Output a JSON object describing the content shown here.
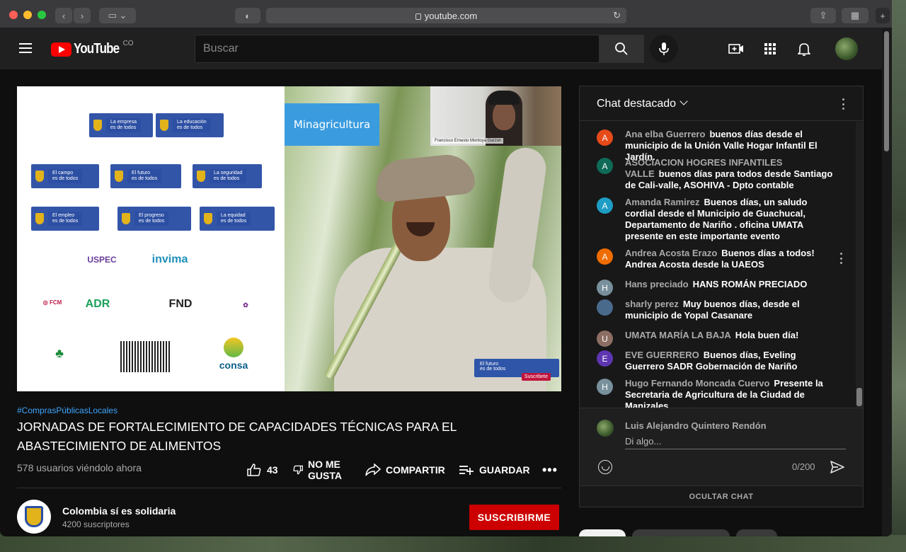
{
  "browser": {
    "url": "youtube.com"
  },
  "header": {
    "logo_text": "YouTube",
    "country_code": "CO",
    "search_placeholder": "Buscar"
  },
  "video": {
    "slide": {
      "minagri_label": "Minagricultura",
      "camera_name": "Francisco Ernesto Montoya Garzon",
      "badge_line1": "El futuro",
      "badge_line2": "es de todos",
      "badge_sub": "Suscribete"
    },
    "hashtag": "#ComprasPúblicasLocales",
    "title": "JORNADAS DE FORTALECIMIENTO DE CAPACIDADES TÉCNICAS PARA EL ABASTECIMIENTO DE ALIMENTOS",
    "viewers": "578 usuarios viéndolo ahora",
    "like_count": "43",
    "dislike_label_1": "NO ME",
    "dislike_label_2": "GUSTA",
    "share_label": "COMPARTIR",
    "save_label": "GUARDAR"
  },
  "channel": {
    "name": "Colombia sí es solidaria",
    "subscribers": "4200 suscriptores",
    "subscribe_label": "SUSCRIBIRME"
  },
  "chat": {
    "title": "Chat destacado",
    "messages": [
      {
        "initial": "A",
        "color": "#e64a19",
        "author": "Ana elba Guerrero",
        "text": "buenos días desde el municipio de la Unión Valle Hogar Infantil El Jardín."
      },
      {
        "initial": "A",
        "color": "#0f6b57",
        "author": "ASOCIACION HOGRES INFANTILES VALLE",
        "text": "buenos días para todos desde Santiago de Cali-valle, ASOHIVA - Dpto contable"
      },
      {
        "initial": "A",
        "color": "#1e9dc4",
        "author": "Amanda Ramirez",
        "text": "Buenos días, un saludo cordial desde el Municipio de Guachucal, Departamento de Nariño . oficina UMATA presente en este importante evento"
      },
      {
        "initial": "A",
        "color": "#ef6c00",
        "author": "Andrea Acosta Erazo",
        "text": "Buenos días a todos! Andrea Acosta desde la UAEOS"
      },
      {
        "initial": "H",
        "color": "#78909c",
        "author": "Hans preciado",
        "text": "HANS ROMÁN PRECIADO"
      },
      {
        "initial": "",
        "color": "#4a6a8c",
        "author": "sharly perez",
        "text": "Muy buenos días, desde el municipio de Yopal Casanare"
      },
      {
        "initial": "U",
        "color": "#8d6e63",
        "author": "UMATA MARÍA LA BAJA",
        "text": "Hola buen día!"
      },
      {
        "initial": "E",
        "color": "#5e35b1",
        "author": "EVE GUERRERO",
        "text": "Buenos días, Eveling Guerrero SADR Gobernación de Nariño"
      },
      {
        "initial": "H",
        "color": "#78909c",
        "author": "Hugo Fernando Moncada Cuervo",
        "text": "Presente la Secretaria de Agricultura de la Ciudad de Manizales"
      }
    ],
    "current_user": "Luis Alejandro Quintero Rendón",
    "input_placeholder": "Di algo...",
    "char_counter": "0/200",
    "hide_label": "OCULTAR CHAT"
  }
}
